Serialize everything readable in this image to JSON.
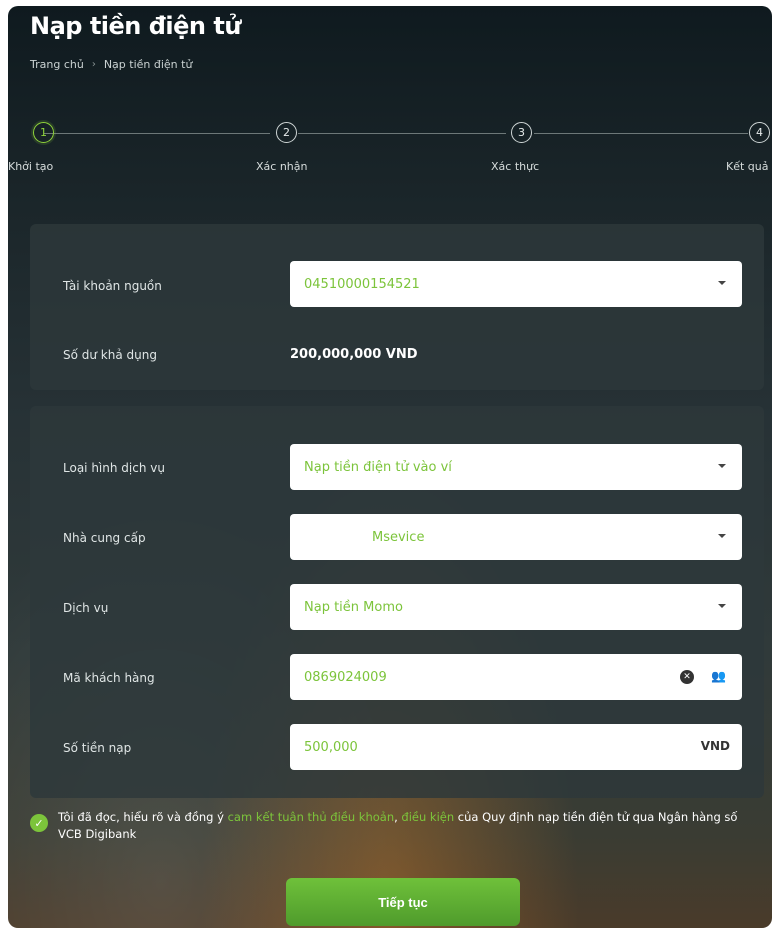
{
  "page": {
    "title": "Nạp tiền điện tử"
  },
  "breadcrumb": {
    "home": "Trang chủ",
    "current": "Nạp tiền điện tử"
  },
  "steps": [
    {
      "number": "1",
      "label": "Khởi tạo",
      "active": true
    },
    {
      "number": "2",
      "label": "Xác nhận",
      "active": false
    },
    {
      "number": "3",
      "label": "Xác thực",
      "active": false
    },
    {
      "number": "4",
      "label": "Kết quả",
      "active": false
    }
  ],
  "source": {
    "account_label": "Tài khoản nguồn",
    "account_value": "04510000154521",
    "balance_label": "Số dư khả dụng",
    "balance_value": "200,000,000 VND"
  },
  "form": {
    "service_type_label": "Loại hình dịch vụ",
    "service_type_value": "Nạp tiền điện tử vào ví",
    "provider_label": "Nhà cung cấp",
    "provider_value": "Msevice",
    "service_label": "Dịch vụ",
    "service_value": "Nạp tiền Momo",
    "customer_code_label": "Mã khách hàng",
    "customer_code_value": "0869024009",
    "amount_label": "Số tiền nạp",
    "amount_value": "500,000",
    "amount_unit": "VND"
  },
  "consent": {
    "text_before": "Tôi đã đọc, hiểu rõ và đồng ý ",
    "link1": "cam kết tuân thủ điều khoản",
    "sep": ", ",
    "link2": "điều kiện",
    "text_after": " của Quy định nạp tiền điện tử qua Ngân hàng số VCB Digibank",
    "checked": true
  },
  "actions": {
    "continue_label": "Tiếp tục"
  },
  "colors": {
    "accent": "#7cc43b",
    "panel": "#2d383b"
  }
}
